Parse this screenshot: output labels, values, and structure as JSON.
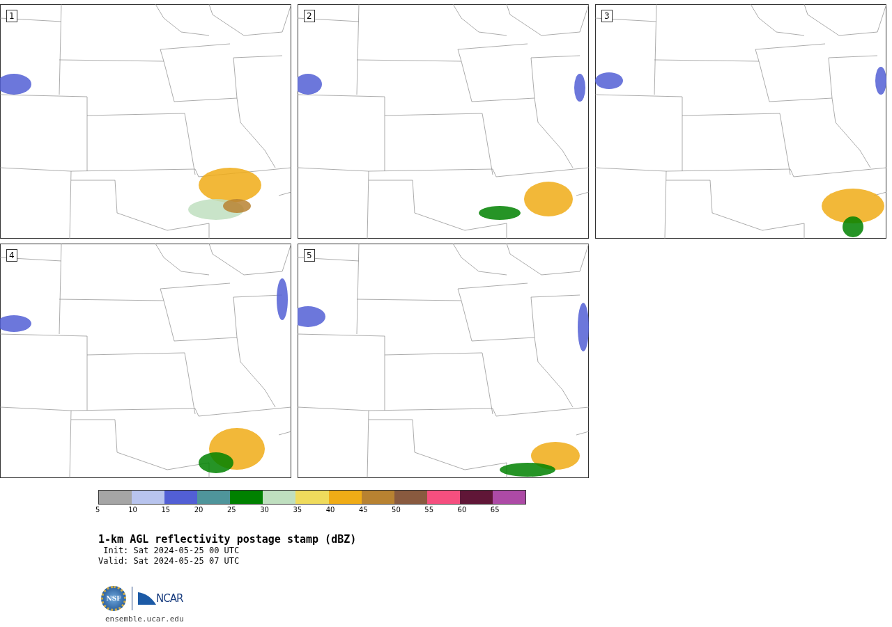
{
  "panels": [
    {
      "label": "1"
    },
    {
      "label": "2"
    },
    {
      "label": "3"
    },
    {
      "label": "4"
    },
    {
      "label": "5"
    }
  ],
  "colorbar": [
    {
      "color": "#a5a5a5",
      "label": "5"
    },
    {
      "color": "#b8c4ee",
      "label": "10"
    },
    {
      "color": "#525fd5",
      "label": "15"
    },
    {
      "color": "#4f959b",
      "label": "20"
    },
    {
      "color": "#008100",
      "label": "25"
    },
    {
      "color": "#bfdfbf",
      "label": "30"
    },
    {
      "color": "#efdb5c",
      "label": "35"
    },
    {
      "color": "#f0ac16",
      "label": "40"
    },
    {
      "color": "#b88231",
      "label": "45"
    },
    {
      "color": "#895a3f",
      "label": "50"
    },
    {
      "color": "#f54f7f",
      "label": "55"
    },
    {
      "color": "#601637",
      "label": "60"
    },
    {
      "color": "#ad4aa6",
      "label": "65"
    }
  ],
  "title": "1-km AGL reflectivity postage stamp (dBZ)",
  "init": " Init: Sat 2024-05-25 00 UTC",
  "valid": "Valid: Sat 2024-05-25 07 UTC",
  "logo": {
    "left": "NSF",
    "right": "NCAR"
  },
  "url": "ensemble.ucar.edu"
}
